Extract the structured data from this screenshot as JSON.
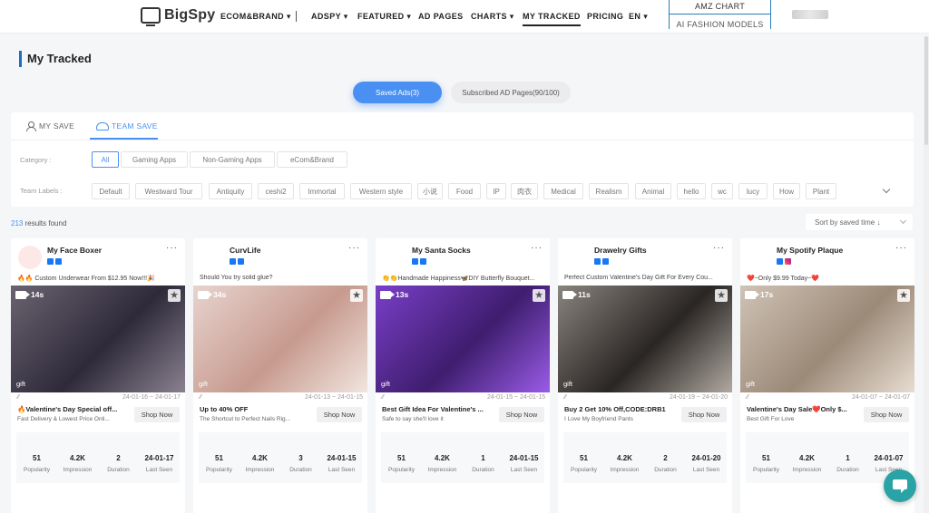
{
  "nav": {
    "logo": "BigSpy",
    "items": [
      {
        "label": "ECOM&BRAND",
        "caret": true
      },
      {
        "label": "ADSPY",
        "caret": true
      },
      {
        "label": "FEATURED",
        "caret": true
      },
      {
        "label": "AD PAGES",
        "caret": false
      },
      {
        "label": "CHARTS",
        "caret": true
      },
      {
        "label": "MY TRACKED",
        "caret": false
      },
      {
        "label": "PRICING",
        "caret": false
      },
      {
        "label": "EN",
        "caret": true
      }
    ],
    "dropdown": [
      "AMZ CHART",
      "AI FASHION MODELS"
    ]
  },
  "page": {
    "title": "My Tracked"
  },
  "toggle": {
    "saved": "Saved Ads(3)",
    "subscribed": "Subscribed AD Pages(90/100)"
  },
  "filters": {
    "tabs": [
      "MY SAVE",
      "TEAM SAVE"
    ],
    "category_label": "Category :",
    "categories": [
      "All",
      "Gaming Apps",
      "Non-Gaming Apps",
      "eCom&Brand"
    ],
    "team_labels_label": "Team Labels :",
    "team_labels": [
      "Default",
      "Westward Tour",
      "Antiquity",
      "ceshi2",
      "Immortal",
      "Western style",
      "小说",
      "Food",
      "IP",
      "肉衣",
      "Medical",
      "Realism",
      "Animal",
      "hello",
      "wc",
      "lucy",
      "How",
      "Plant"
    ]
  },
  "results": {
    "count": "213",
    "suffix": " results found",
    "sort": "Sort by saved time ↓"
  },
  "stat_labels": [
    "Popularity",
    "Impression",
    "Duration",
    "Last Seen"
  ],
  "shop_label": "Shop Now",
  "cards": [
    {
      "brand": "My Face Boxer",
      "platforms": [
        "fb",
        "fb"
      ],
      "ad_text": "🔥🔥 Custom Underwear From $12.95 Now!!!🎉",
      "duration": "14s",
      "tag": "gift",
      "date_range": "24-01-16 ~ 24-01-17",
      "headline": "🔥Valentine's Day Special off...",
      "subline": "Fast Delivery & Lowest Price Onli...",
      "popularity": "51",
      "impression": "4.2K",
      "duration_days": "2",
      "last_seen": "24-01-17",
      "logo_color": "#fde8e8",
      "media_colors": [
        "#6b6370",
        "#2e2a3a",
        "#8a8190"
      ]
    },
    {
      "brand": "CurvLife",
      "platforms": [
        "fb",
        "fb"
      ],
      "ad_text": "Should You try solid glue?",
      "duration": "34s",
      "tag": "gift",
      "date_range": "24-01-13 ~ 24-01-15",
      "headline": "Up to 40% OFF",
      "subline": "The Shortcut to Perfect Nails Rig...",
      "popularity": "51",
      "impression": "4.2K",
      "duration_days": "3",
      "last_seen": "24-01-15",
      "logo_color": "#ffffff",
      "media_colors": [
        "#e7d4cf",
        "#c79a8e",
        "#f1e5df"
      ]
    },
    {
      "brand": "My Santa Socks",
      "platforms": [
        "fb",
        "fb"
      ],
      "ad_text": "👏👏Handmade Happiness🦋DIY Butterfly Bouquet...",
      "duration": "13s",
      "tag": "gift",
      "date_range": "24-01-15 ~ 24-01-15",
      "headline": "Best Gift Idea For Valentine's ...",
      "subline": "Safe to say she'll love it",
      "popularity": "51",
      "impression": "4.2K",
      "duration_days": "1",
      "last_seen": "24-01-15",
      "logo_color": "#ffffff",
      "media_colors": [
        "#7a3fc9",
        "#3f1d6e",
        "#9a5ce8"
      ]
    },
    {
      "brand": "Drawelry Gifts",
      "platforms": [
        "fb",
        "fb"
      ],
      "ad_text": "Perfect Custom Valentine's Day Gift For Every Cou...",
      "duration": "11s",
      "tag": "gift",
      "date_range": "24-01-19 ~ 24-01-20",
      "headline": "Buy 2 Get 10% Off,CODE:DRB1",
      "subline": "I Love My Boyfriend Pants",
      "popularity": "51",
      "impression": "4.2K",
      "duration_days": "2",
      "last_seen": "24-01-20",
      "logo_color": "#ffffff",
      "media_colors": [
        "#8a847e",
        "#2a2624",
        "#b0a9a1"
      ]
    },
    {
      "brand": "My Spotify Plaque",
      "platforms": [
        "fb",
        "ig"
      ],
      "ad_text": "❤️~Only $9.99 Today~❤️",
      "duration": "17s",
      "tag": "gift",
      "date_range": "24-01-07 ~ 24-01-07",
      "headline": "Valentine's Day Sale❤️Only $...",
      "subline": "Best Gift For Love",
      "popularity": "51",
      "impression": "4.2K",
      "duration_days": "1",
      "last_seen": "24-01-07",
      "logo_color": "#ffffff",
      "media_colors": [
        "#cfc3b6",
        "#9c8a78",
        "#e8ddd2"
      ]
    }
  ]
}
